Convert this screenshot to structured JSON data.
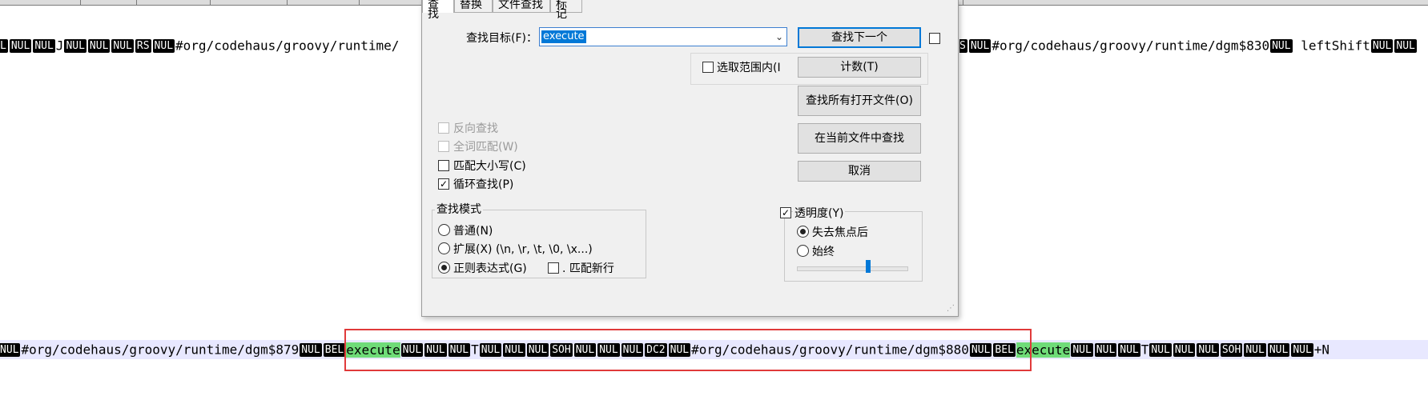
{
  "background": {
    "line1": {
      "tokens_left": [
        "L",
        "NUL",
        "NUL",
        "J",
        "NUL",
        "NUL",
        "NUL",
        "RS",
        "NUL"
      ],
      "text_left": "#org/codehaus/groovy/runtime/",
      "tokens_right": [
        "S",
        "NUL"
      ],
      "text_right": "#org/codehaus/groovy/runtime/dgm$830",
      "token_after": "NUL",
      "text_after": " leftShift",
      "tokens_end": [
        "NUL",
        "NUL"
      ]
    },
    "line2": {
      "tok0": "NUL",
      "text0": "#org/codehaus/groovy/runtime/dgm$879",
      "tok1": "NUL",
      "tok2": "BEL",
      "match1": "execute",
      "tokens_a": [
        "NUL",
        "NUL",
        "NUL"
      ],
      "t1": "T",
      "tokens_b": [
        "NUL",
        "NUL",
        "NUL",
        "SOH",
        "NUL",
        "NUL",
        "NUL",
        "DC2",
        "NUL"
      ],
      "text1": "#org/codehaus/groovy/runtime/dgm$880",
      "tok3": "NUL",
      "tok4": "BEL",
      "match2": "execute",
      "tokens_c": [
        "NUL",
        "NUL",
        "NUL"
      ],
      "t2": "T",
      "tokens_d": [
        "NUL",
        "NUL",
        "NUL",
        "SOH",
        "NUL",
        "NUL",
        "NUL"
      ],
      "tail": "+N"
    }
  },
  "dialog": {
    "tabs": [
      "查找",
      "替换",
      "文件查找",
      "标记"
    ],
    "find_label": "查找目标(F)：",
    "find_value": "execute",
    "find_next_button": "查找下一个",
    "count_button": "计数(T)",
    "find_all_open_button": "查找所有打开文件(O)",
    "find_in_current_button": "在当前文件中查找",
    "cancel_button": "取消",
    "in_selection_label": "选取范围内(I",
    "options": {
      "backward": "反向查找",
      "whole_word": "全词匹配(W)",
      "match_case": "匹配大小写(C)",
      "wrap_around": "循环查找(P)"
    },
    "search_mode": {
      "title": "查找模式",
      "normal": "普通(N)",
      "extended": "扩展(X) (\\n, \\r, \\t, \\0, \\x...)",
      "regex": "正则表达式(G)",
      "dot_newline": ". 匹配新行",
      "checked_symbol": "✓"
    },
    "transparency": {
      "title": "透明度(Y)",
      "on_lose_focus": "失去焦点后",
      "always": "始终",
      "level": 0.6
    }
  }
}
